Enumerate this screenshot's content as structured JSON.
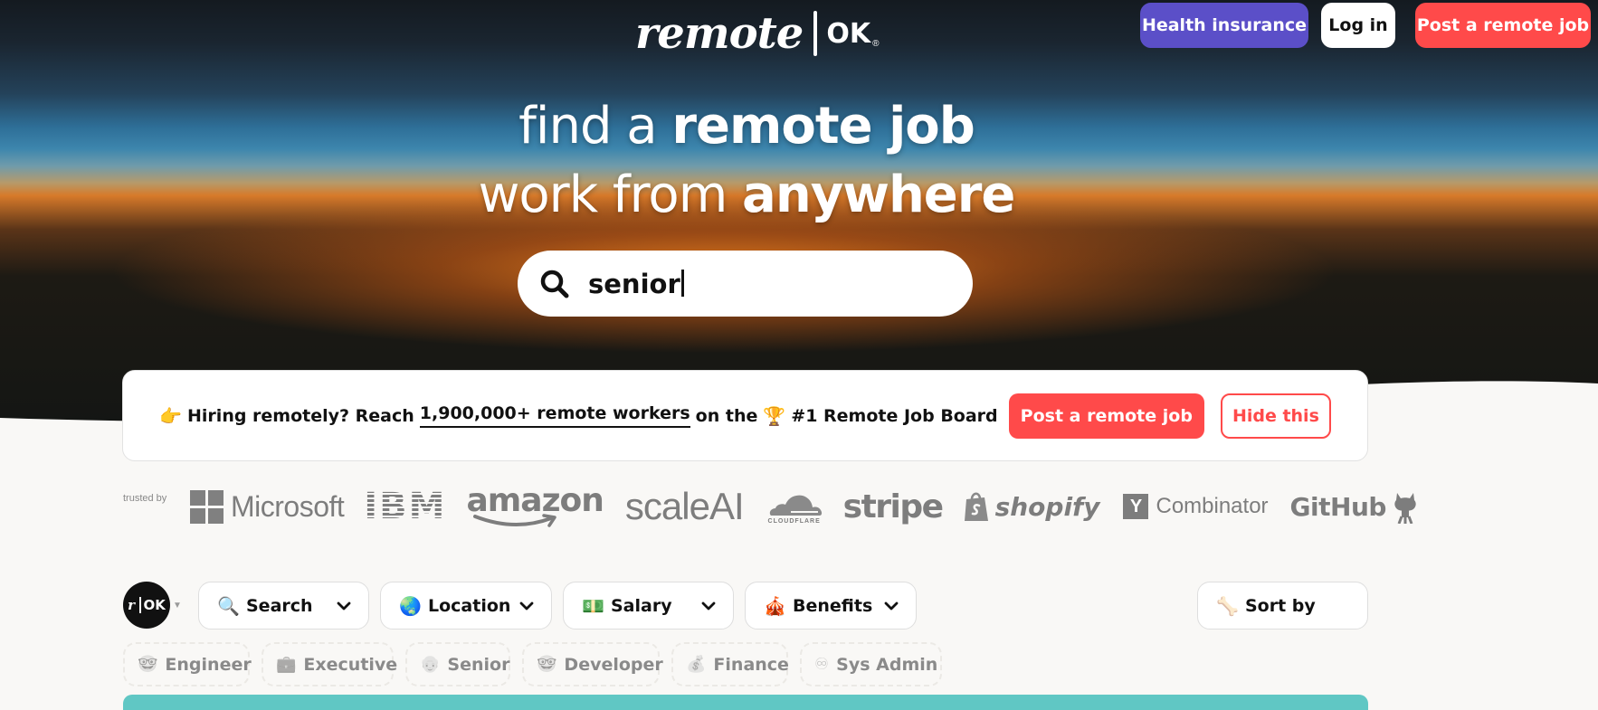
{
  "brand": {
    "logo_script": "remote",
    "logo_ok": "OK",
    "logo_reg": "®"
  },
  "header": {
    "health_insurance": "Health insurance",
    "login": "Log in",
    "post_job": "Post a remote job"
  },
  "hero": {
    "line1_light": "find a ",
    "line1_bold": "remote job",
    "line2_light": "work from ",
    "line2_bold": "anywhere",
    "search_value": "senior"
  },
  "banner": {
    "emoji_point": "👉",
    "text_before": "Hiring remotely? Reach ",
    "link_text": "1,900,000+ remote workers",
    "text_mid": " on the ",
    "emoji_trophy": "🏆",
    "text_after": " #1 Remote Job Board",
    "post_button": "Post a remote job",
    "hide_button": "Hide this"
  },
  "trusted": {
    "label": "trusted by",
    "logos": [
      "Microsoft",
      "IBM",
      "amazon",
      "scaleAI",
      "CLOUDFLARE",
      "stripe",
      "shopify",
      "Combinator",
      "GitHub"
    ],
    "yc_letter": "Y"
  },
  "filters": {
    "avatar_r": "r",
    "avatar_ok": "OK",
    "search": {
      "label": "Search",
      "icon": "🔍"
    },
    "location": {
      "label": "Location",
      "icon": "🌏"
    },
    "salary": {
      "label": "Salary",
      "icon": "💵"
    },
    "benefits": {
      "label": "Benefits",
      "icon": "🎪"
    },
    "sort": {
      "label": "Sort by",
      "icon": "🦴"
    }
  },
  "tags": [
    {
      "label": "Engineer",
      "icon": "🤓"
    },
    {
      "label": "Executive",
      "icon": "💼"
    },
    {
      "label": "Senior",
      "icon": "👴"
    },
    {
      "label": "Developer",
      "icon": "🤓"
    },
    {
      "label": "Finance",
      "icon": "💰"
    },
    {
      "label": "Sys Admin",
      "icon": "♾"
    }
  ],
  "colors": {
    "accent_red": "#ff4a4a",
    "health_purple": "#5b4fc8",
    "teal": "#60c7c4"
  }
}
